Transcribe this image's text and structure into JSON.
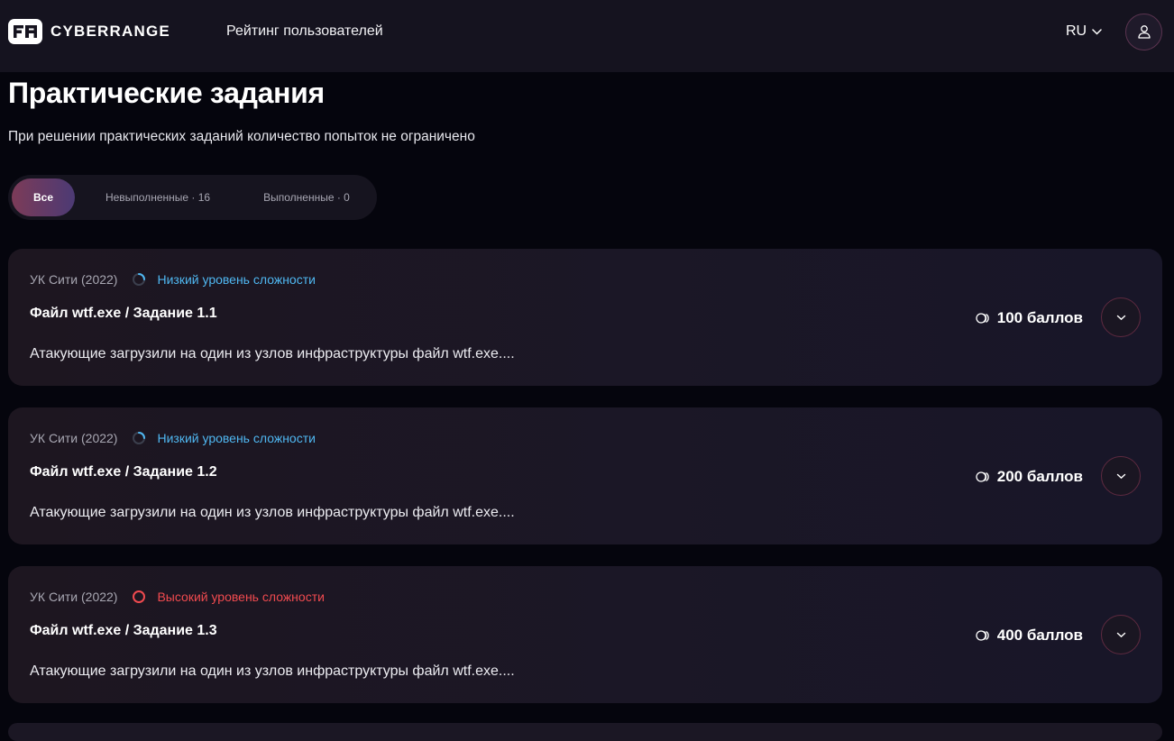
{
  "header": {
    "brand": "CYBERRANGE",
    "nav_link": "Рейтинг пользователей",
    "language": "RU"
  },
  "main": {
    "title": "Практические задания",
    "subtitle": "При решении практических заданий количество попыток не ограничено",
    "filters": [
      {
        "label": "Все",
        "active": true
      },
      {
        "label": "Невыполненные · 16",
        "active": false
      },
      {
        "label": "Выполненные · 0",
        "active": false
      }
    ]
  },
  "tasks": [
    {
      "company": "УК Сити (2022)",
      "difficulty": "Низкий уровень сложности",
      "difficulty_level": "low",
      "title": "Файл wtf.exe / Задание 1.1",
      "description": "Атакующие загрузили на один из узлов инфраструктуры файл wtf.exe....",
      "points": "100 баллов"
    },
    {
      "company": "УК Сити (2022)",
      "difficulty": "Низкий уровень сложности",
      "difficulty_level": "low",
      "title": "Файл wtf.exe / Задание 1.2",
      "description": "Атакующие загрузили на один из узлов инфраструктуры файл wtf.exe....",
      "points": "200 баллов"
    },
    {
      "company": "УК Сити (2022)",
      "difficulty": "Высокий уровень сложности",
      "difficulty_level": "high",
      "title": "Файл wtf.exe / Задание 1.3",
      "description": "Атакующие загрузили на один из узлов инфраструктуры файл wtf.exe....",
      "points": "400 баллов"
    }
  ],
  "colors": {
    "background": "#05050d",
    "topbar": "#15131f",
    "difficulty_low": "#4fb7f1",
    "difficulty_high": "#f04a4f",
    "accent_gradient_start": "#7c3b58",
    "accent_gradient_end": "#4c3a74"
  },
  "icons": {
    "logo": "cyberrange-logo",
    "language_dropdown": "chevron-down-icon",
    "profile": "user-icon",
    "difficulty": "progress-ring-icon",
    "points": "coin-icon",
    "expand": "chevron-down-icon"
  }
}
